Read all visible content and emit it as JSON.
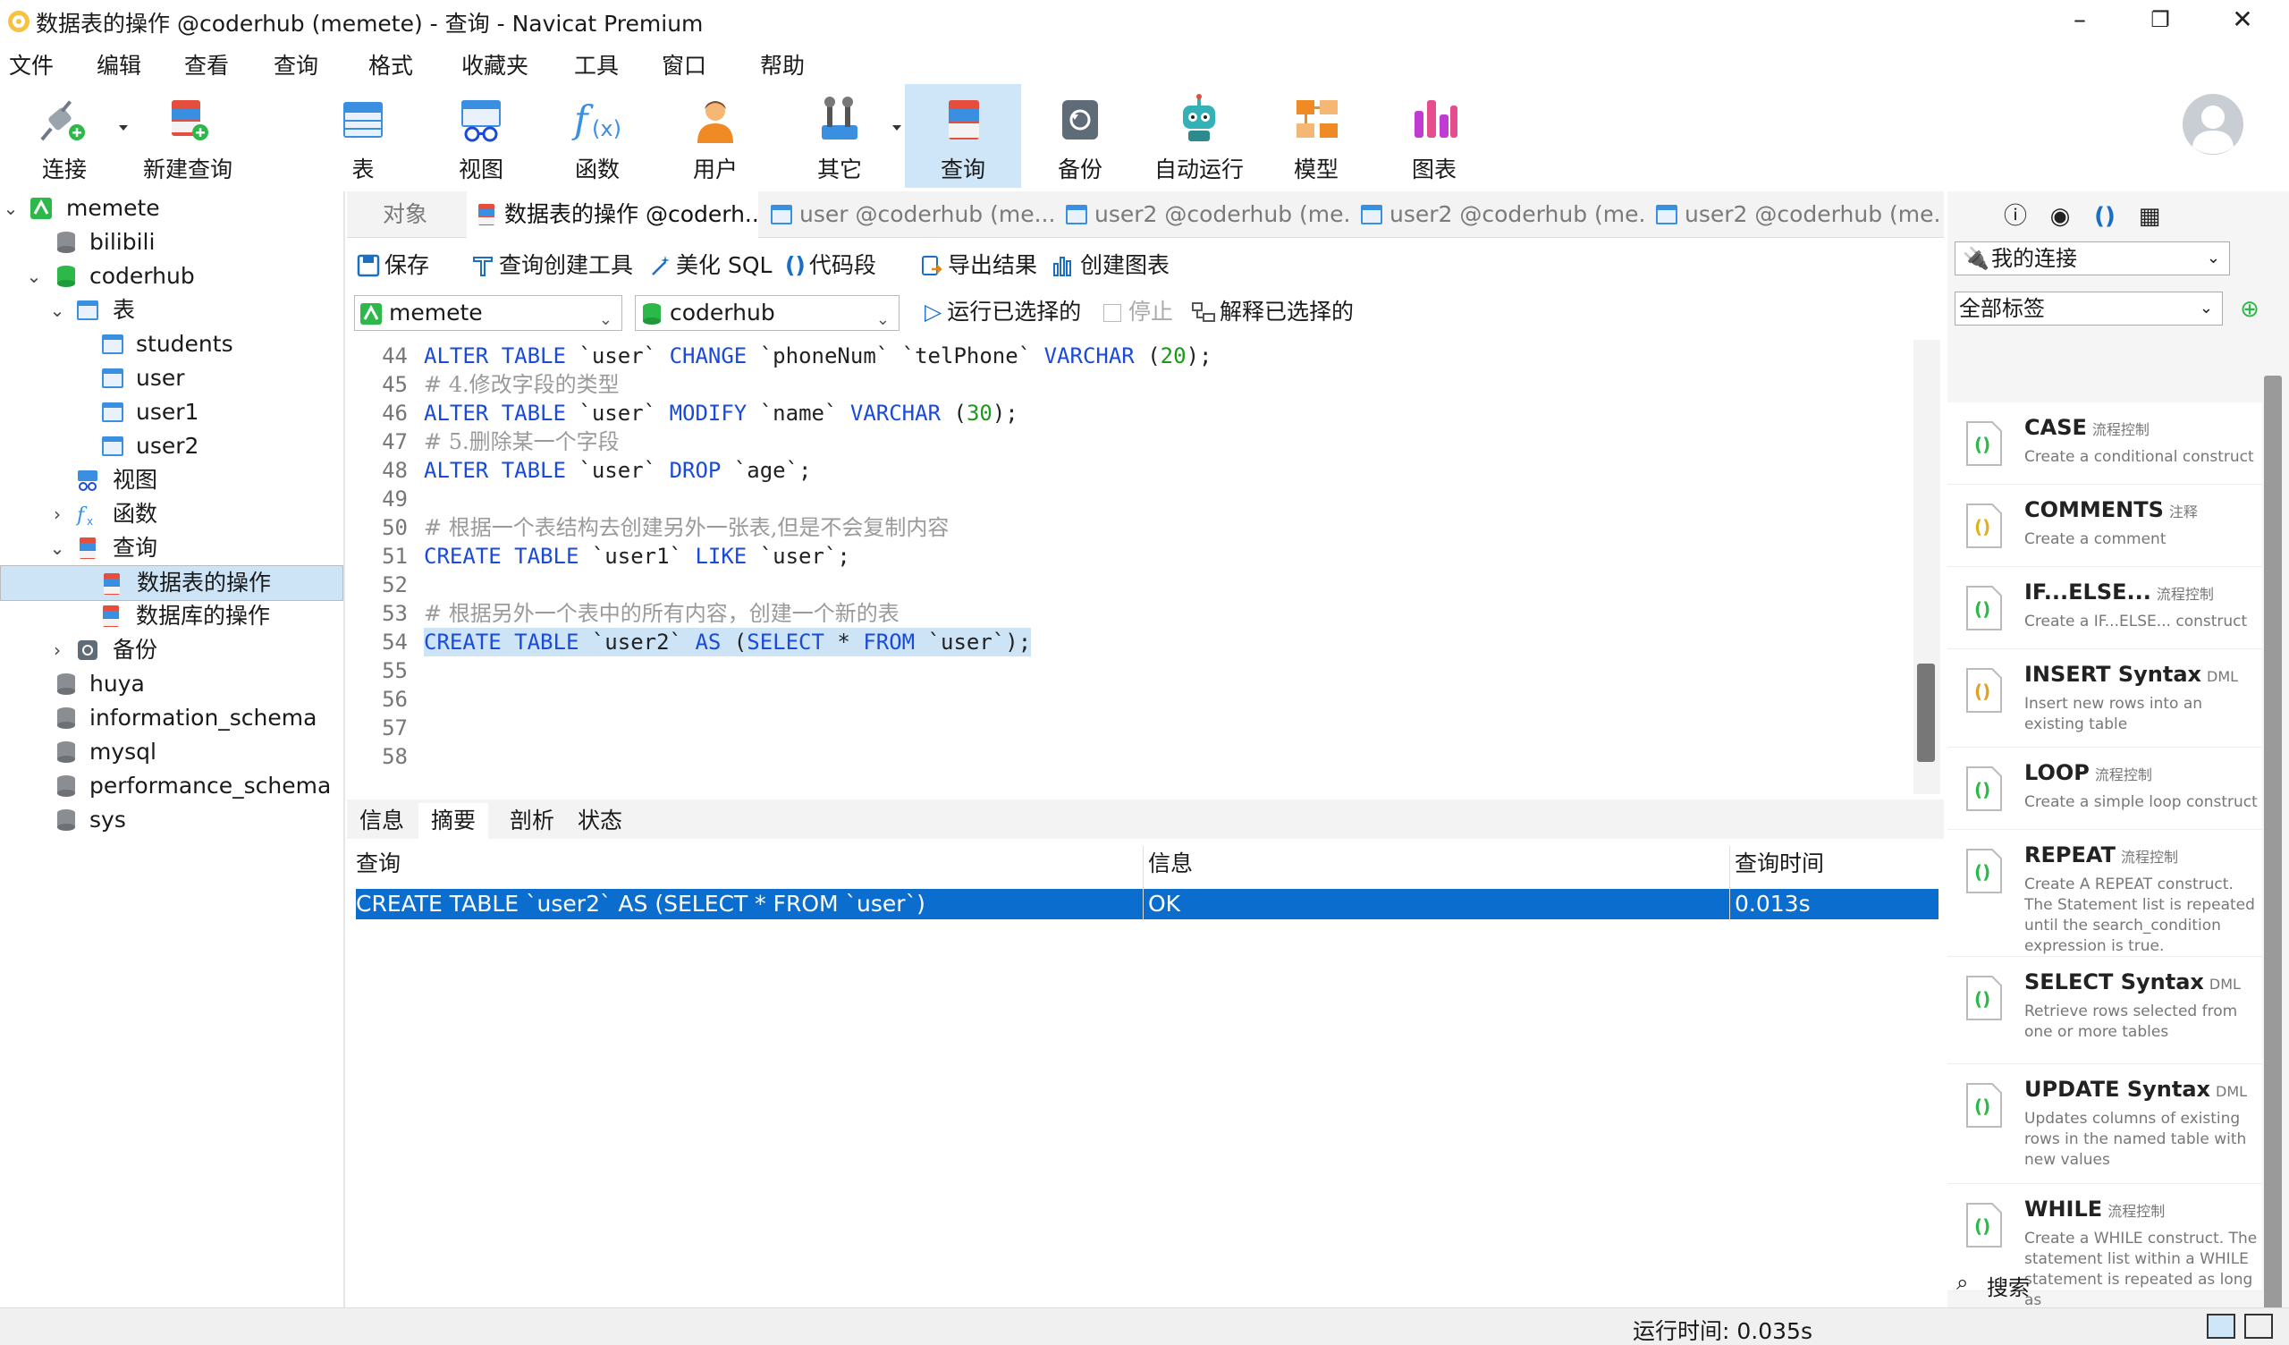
{
  "window": {
    "title": "数据表的操作 @coderhub (memete) - 查询 - Navicat Premium"
  },
  "menu": [
    "文件",
    "编辑",
    "查看",
    "查询",
    "格式",
    "收藏夹",
    "工具",
    "窗口",
    "帮助"
  ],
  "toolbar": {
    "connect": "连接",
    "new_query": "新建查询",
    "table": "表",
    "view": "视图",
    "function": "函数",
    "user": "用户",
    "other": "其它",
    "query": "查询",
    "backup": "备份",
    "auto_run": "自动运行",
    "model": "模型",
    "chart": "图表"
  },
  "tree": {
    "root": "memete",
    "db1": "bilibili",
    "db2": "coderhub",
    "tables": "表",
    "t1": "students",
    "t2": "user",
    "t3": "user1",
    "t4": "user2",
    "views": "视图",
    "functions": "函数",
    "queries": "查询",
    "q1": "数据表的操作",
    "q2": "数据库的操作",
    "backups": "备份",
    "db3": "huya",
    "db4": "information_schema",
    "db5": "mysql",
    "db6": "performance_schema",
    "db7": "sys"
  },
  "tabs": [
    "对象",
    "数据表的操作 @coderh...",
    "user @coderhub (me...",
    "user2 @coderhub (me...",
    "user2 @coderhub (me...",
    "user2 @coderhub (me..."
  ],
  "editor_toolbar": {
    "save": "保存",
    "builder": "查询创建工具",
    "beautify": "美化 SQL",
    "snippet": "代码段",
    "export": "导出结果",
    "create_chart": "创建图表"
  },
  "selectors": {
    "connection": "memete",
    "database": "coderhub",
    "run_selected": "运行已选择的",
    "stop": "停止",
    "explain": "解释已选择的"
  },
  "code": [
    {
      "n": "44",
      "t": [
        [
          "kw",
          "ALTER TABLE"
        ],
        [
          "",
          "`user` "
        ],
        [
          "kw",
          "CHANGE"
        ],
        [
          "",
          "`phoneNum` `telPhone` "
        ],
        [
          "kw",
          "VARCHAR"
        ],
        [
          "",
          "("
        ],
        [
          "num",
          "20"
        ],
        [
          "",
          ");"
        ]
      ]
    },
    {
      "n": "45",
      "t": [
        [
          "cm",
          "# 4.修改字段的类型"
        ]
      ]
    },
    {
      "n": "46",
      "t": [
        [
          "kw",
          "ALTER TABLE"
        ],
        [
          "",
          "`user` "
        ],
        [
          "kw",
          "MODIFY"
        ],
        [
          "",
          "`name` "
        ],
        [
          "kw",
          "VARCHAR"
        ],
        [
          "",
          "("
        ],
        [
          "num",
          "30"
        ],
        [
          "",
          ");"
        ]
      ]
    },
    {
      "n": "47",
      "t": [
        [
          "cm",
          "# 5.删除某一个字段"
        ]
      ]
    },
    {
      "n": "48",
      "t": [
        [
          "kw",
          "ALTER TABLE"
        ],
        [
          "",
          "`user` "
        ],
        [
          "kw",
          "DROP"
        ],
        [
          "",
          "`age`;"
        ]
      ]
    },
    {
      "n": "49",
      "t": []
    },
    {
      "n": "50",
      "t": [
        [
          "cm",
          "# 根据一个表结构去创建另外一张表,但是不会复制内容"
        ]
      ]
    },
    {
      "n": "51",
      "t": [
        [
          "kw",
          "CREATE TABLE"
        ],
        [
          "",
          "`user1` "
        ],
        [
          "kw",
          "LIKE"
        ],
        [
          "",
          "`user`;"
        ]
      ]
    },
    {
      "n": "52",
      "t": []
    },
    {
      "n": "53",
      "t": [
        [
          "cm",
          "# 根据另外一个表中的所有内容，创建一个新的表"
        ]
      ]
    },
    {
      "n": "54",
      "t": [
        [
          "kw",
          "CREATE TABLE"
        ],
        [
          "",
          "`user2` "
        ],
        [
          "kw",
          "AS"
        ],
        [
          "",
          "("
        ],
        [
          "kw",
          "SELECT"
        ],
        [
          "",
          "* "
        ],
        [
          "kw",
          "FROM"
        ],
        [
          "",
          "`user`);"
        ]
      ],
      "hl": true
    },
    {
      "n": "55",
      "t": []
    },
    {
      "n": "56",
      "t": []
    },
    {
      "n": "57",
      "t": []
    },
    {
      "n": "58",
      "t": []
    }
  ],
  "result_tabs": [
    "信息",
    "摘要",
    "剖析",
    "状态"
  ],
  "result": {
    "headers": [
      "查询",
      "信息",
      "查询时间"
    ],
    "row": [
      "CREATE TABLE `user2` AS (SELECT * FROM `user`)",
      "OK",
      "0.013s"
    ]
  },
  "right_panel": {
    "connection": "我的连接",
    "tags": "全部标签",
    "search": "搜索",
    "snippets": [
      {
        "title": "CASE",
        "cat": "流程控制",
        "desc": "Create a conditional construct"
      },
      {
        "title": "COMMENTS",
        "cat": "注释",
        "desc": "Create a comment"
      },
      {
        "title": "IF...ELSE...",
        "cat": "流程控制",
        "desc": "Create a IF...ELSE... construct"
      },
      {
        "title": "INSERT Syntax",
        "cat": "DML",
        "desc": "Insert new rows into an existing table"
      },
      {
        "title": "LOOP",
        "cat": "流程控制",
        "desc": "Create a simple loop construct"
      },
      {
        "title": "REPEAT",
        "cat": "流程控制",
        "desc": "Create A REPEAT construct. The Statement list is repeated until the search_condition expression is true."
      },
      {
        "title": "SELECT Syntax",
        "cat": "DML",
        "desc": "Retrieve rows selected from one or more tables"
      },
      {
        "title": "UPDATE Syntax",
        "cat": "DML",
        "desc": "Updates columns of existing rows in the named table with new values"
      },
      {
        "title": "WHILE",
        "cat": "流程控制",
        "desc": "Create a WHILE construct. The statement list within a WHILE statement is repeated as long as"
      }
    ]
  },
  "status": {
    "run_time": "运行时间: 0.035s"
  }
}
